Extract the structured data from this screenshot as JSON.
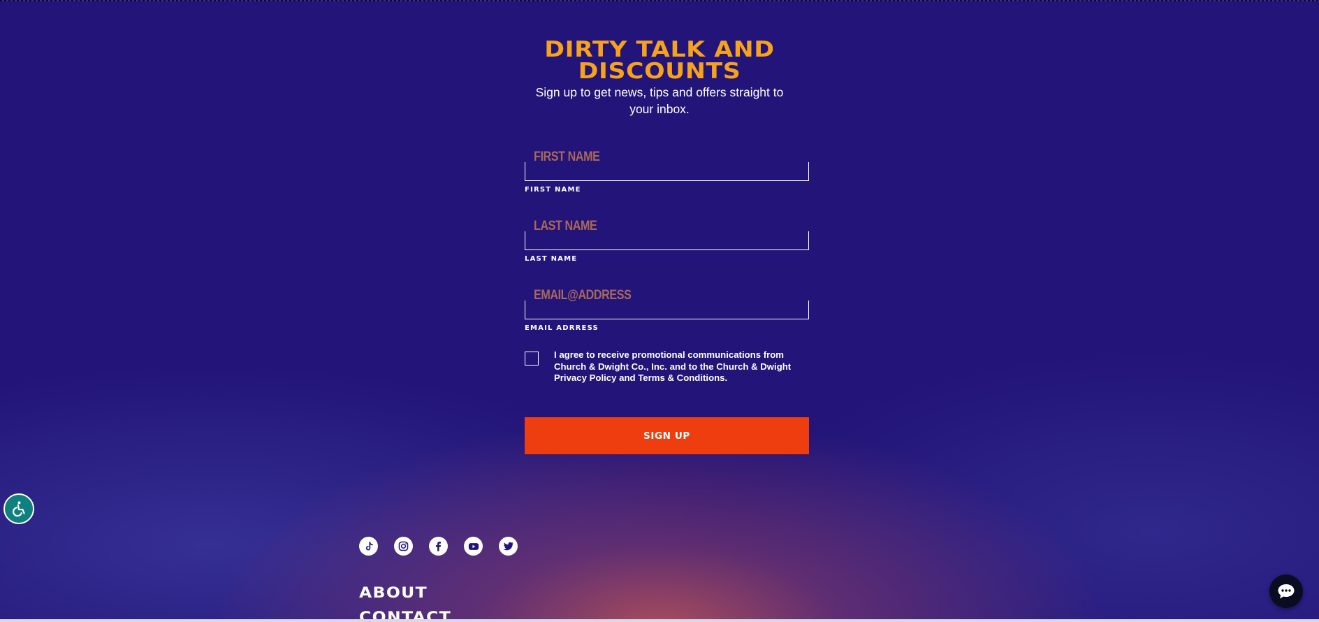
{
  "newsletter": {
    "title": "DIRTY TALK AND DISCOUNTS",
    "subtitle": "Sign up to get news, tips and offers straight to your inbox.",
    "fields": [
      {
        "placeholder": "FIRST NAME",
        "label": "FIRST NAME",
        "value": ""
      },
      {
        "placeholder": "LAST NAME",
        "label": "LAST NAME",
        "value": ""
      },
      {
        "placeholder": "EMAIL@ADDRESS",
        "label": "EMAIL ADRRESS",
        "value": ""
      }
    ],
    "consent": {
      "checked": false,
      "text": "I agree to receive promotional communications from Church & Dwight Co., Inc. and to the Church & Dwight Privacy Policy and Terms & Conditions."
    },
    "submit_label": "SIGN UP"
  },
  "social": [
    {
      "name": "tiktok-icon"
    },
    {
      "name": "instagram-icon"
    },
    {
      "name": "facebook-icon"
    },
    {
      "name": "youtube-icon"
    },
    {
      "name": "twitter-icon"
    }
  ],
  "footer": {
    "links": [
      "ABOUT",
      "CONTACT"
    ]
  },
  "widgets": {
    "accessibility_icon": "wheelchair-icon",
    "chat_icon": "chat-bubble-icon"
  },
  "colors": {
    "background": "#221478",
    "title": "#f7a21b",
    "placeholder": "#a9685a",
    "button": "#ee3d0f",
    "accessibility": "#0f8080",
    "chat": "#0a0d22"
  }
}
